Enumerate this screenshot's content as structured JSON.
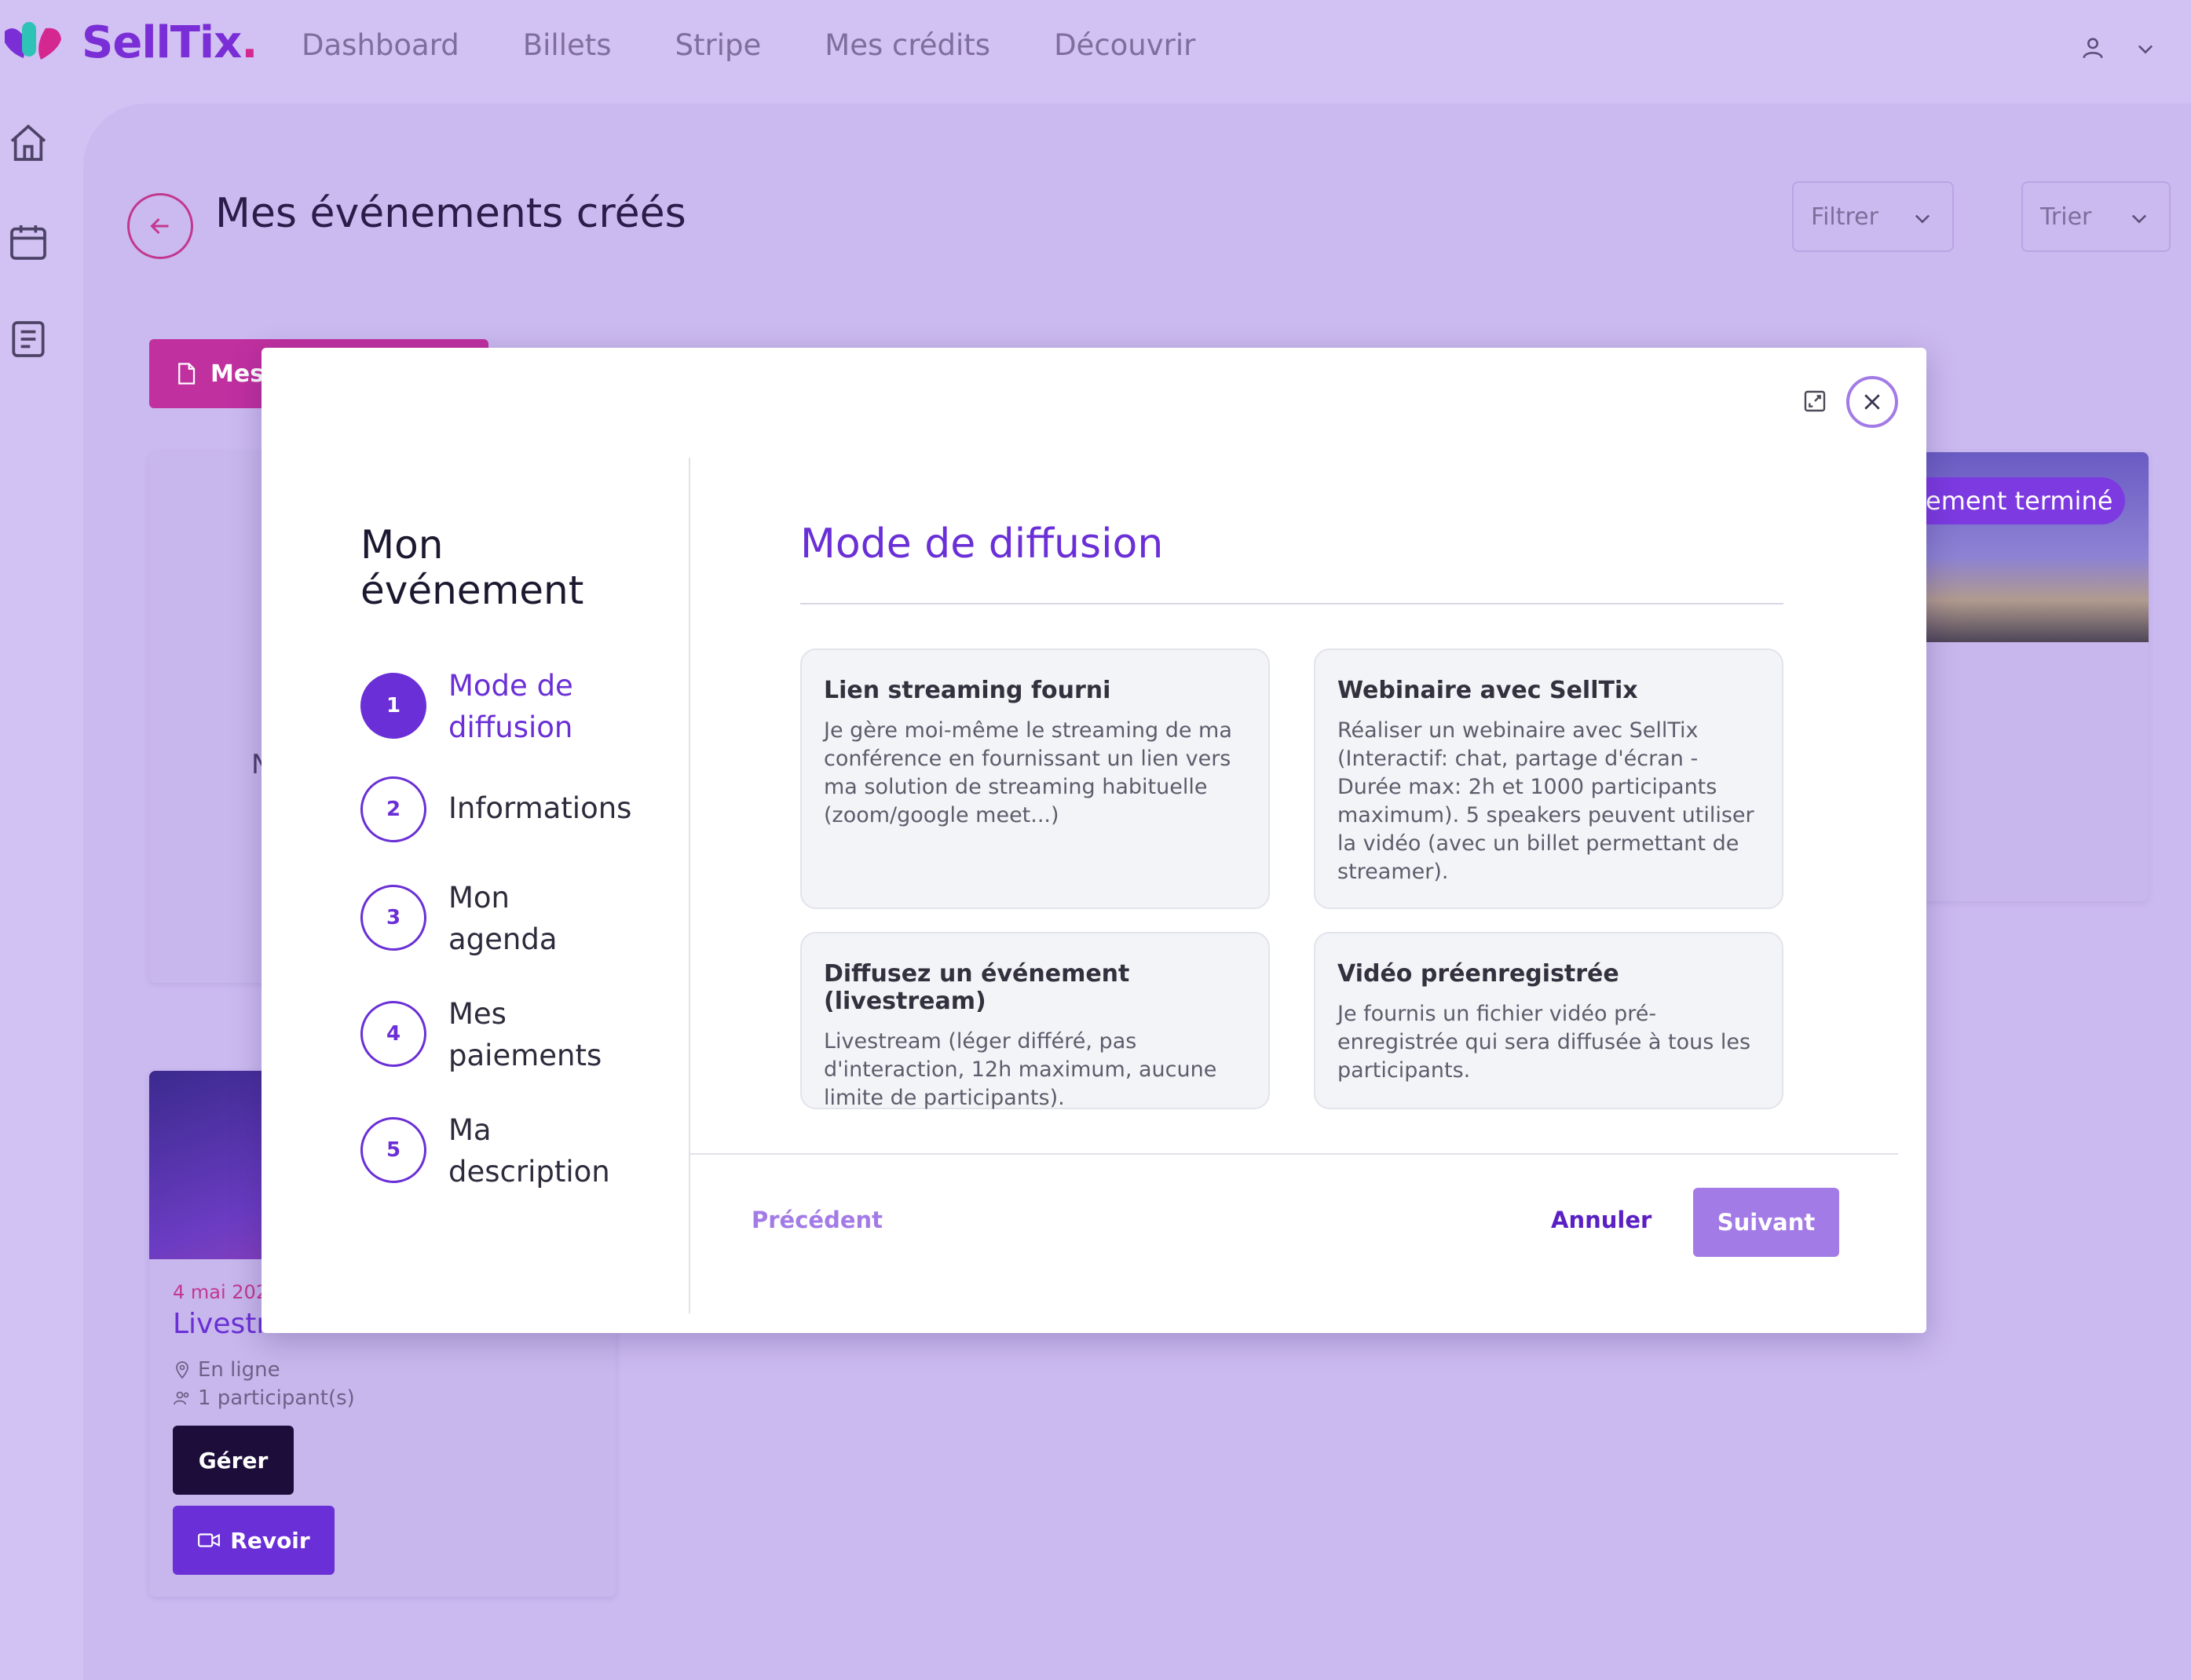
{
  "header": {
    "logo_text": "SellTix",
    "logo_dot": ".",
    "nav": [
      "Dashboard",
      "Billets",
      "Stripe",
      "Mes crédits",
      "Découvrir"
    ],
    "user_icon": "user-icon",
    "menu_icon": "chevron-down-icon"
  },
  "sidebar": {
    "icons": [
      "home-icon",
      "calendar-icon",
      "document-icon"
    ]
  },
  "page": {
    "title": "Mes événements créés",
    "filter_label": "Filtrer",
    "sort_label": "Trier",
    "export_button": "Mes"
  },
  "background_cards": {
    "left_partial_text": "N",
    "right_badge": "ement terminé",
    "event": {
      "date": "4 mai 202",
      "title": "Livestr",
      "location": "En ligne",
      "participants": "1 participant(s)",
      "manage_button": "Gérer",
      "replay_button": "Revoir"
    }
  },
  "modal": {
    "stepper_title": "Mon événement",
    "steps": [
      {
        "number": "1",
        "label": "Mode de diffusion"
      },
      {
        "number": "2",
        "label": "Informations"
      },
      {
        "number": "3",
        "label": "Mon agenda"
      },
      {
        "number": "4",
        "label": "Mes paiements"
      },
      {
        "number": "5",
        "label": "Ma description"
      }
    ],
    "active_step": 1,
    "section_title": "Mode de diffusion",
    "options": [
      {
        "title": "Lien streaming fourni",
        "description": "Je gère moi-même le streaming de ma conférence en fournissant un lien vers ma solution de streaming habituelle (zoom/google meet...)"
      },
      {
        "title": "Webinaire avec SellTix",
        "description": "Réaliser un webinaire avec SellTix (Interactif: chat, partage d'écran - Durée max: 2h et 1000 participants maximum). 5 speakers peuvent utiliser la vidéo (avec un billet permettant de streamer)."
      },
      {
        "title": "Diffusez un événement (livestream)",
        "description": "Livestream (léger différé, pas d'interaction, 12h maximum, aucune limite de participants)."
      },
      {
        "title": "Vidéo préenregistrée",
        "description": "Je fournis un fichier vidéo pré-enregistrée qui sera diffusée à tous les participants."
      }
    ],
    "footer": {
      "previous": "Précédent",
      "cancel": "Annuler",
      "next": "Suivant"
    }
  },
  "colors": {
    "accent": "#6a2fd6",
    "accent_light": "#a37be6",
    "brand_pink": "#c2388f",
    "background": "#d2c1f3"
  }
}
